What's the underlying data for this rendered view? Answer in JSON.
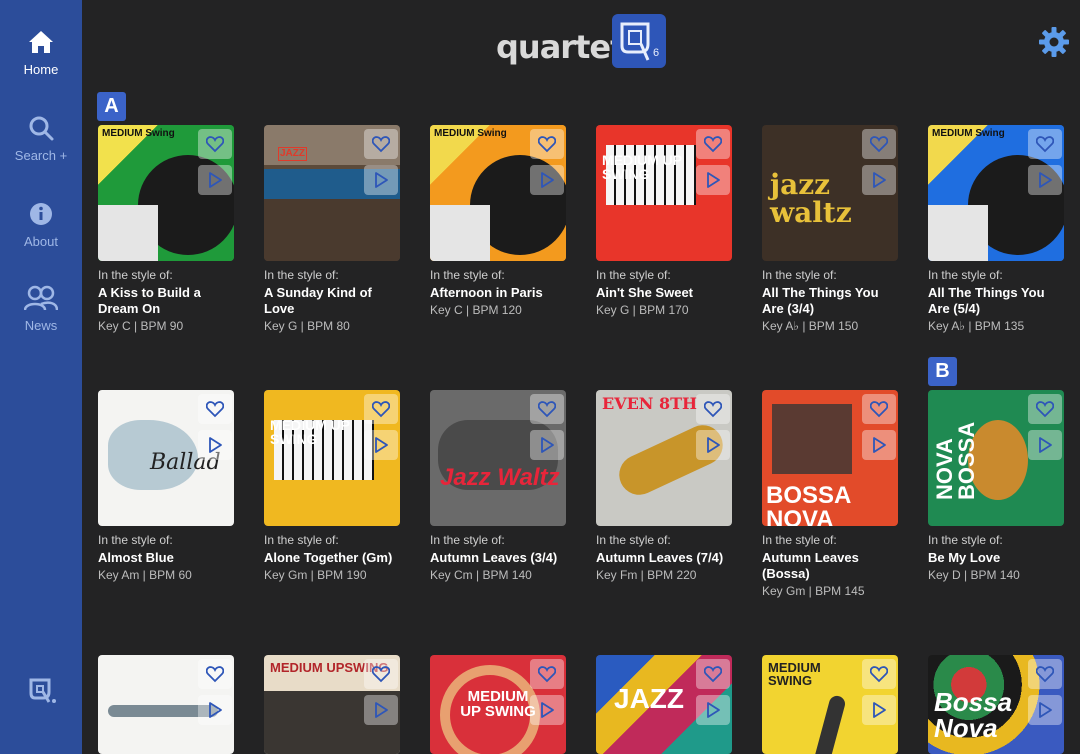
{
  "app": {
    "logo_text": "quartet",
    "logo_badge_superscript": "6"
  },
  "sidebar": {
    "items": [
      {
        "label": "Home",
        "icon": "home-icon",
        "active": true
      },
      {
        "label": "Search +",
        "icon": "search-icon",
        "active": false
      },
      {
        "label": "About",
        "icon": "info-icon",
        "active": false
      },
      {
        "label": "News",
        "icon": "people-icon",
        "active": false
      }
    ]
  },
  "header": {
    "settings_icon": "gear-icon"
  },
  "sections": {
    "a": "A",
    "b": "B"
  },
  "style_prefix": "In the style of:",
  "songs": [
    {
      "title": "A Kiss to Build a Dream On",
      "meta": "Key C | BPM 90",
      "cover": "MEDIUM Swing"
    },
    {
      "title": "A Sunday Kind of Love",
      "meta": "Key G | BPM 80",
      "cover": "JAZZ"
    },
    {
      "title": "Afternoon in Paris",
      "meta": "Key C | BPM 120",
      "cover": "MEDIUM Swing"
    },
    {
      "title": "Ain't She Sweet",
      "meta": "Key G | BPM 170",
      "cover": "MEDIUM UP SWING"
    },
    {
      "title": "All The Things You Are (3/4)",
      "meta": "Key A♭ | BPM 150",
      "cover": "jazz waltz"
    },
    {
      "title": "All The Things You Are (5/4)",
      "meta": "Key A♭ | BPM 135",
      "cover": "MEDIUM Swing"
    },
    {
      "title": "Almost Blue",
      "meta": "Key Am | BPM 60",
      "cover": "Ballad"
    },
    {
      "title": "Alone Together (Gm)",
      "meta": "Key Gm | BPM 190",
      "cover": "MEDIUM UP SWING"
    },
    {
      "title": "Autumn Leaves (3/4)",
      "meta": "Key Cm | BPM 140",
      "cover": "Jazz Waltz"
    },
    {
      "title": "Autumn Leaves (7/4)",
      "meta": "Key Fm | BPM 220",
      "cover": "EVEN 8TH"
    },
    {
      "title": "Autumn Leaves (Bossa)",
      "meta": "Key Gm | BPM 145",
      "cover": "BOSSA NOVA"
    },
    {
      "title": "Be My Love",
      "meta": "Key D | BPM 140",
      "cover": "NOVA BOSSA"
    },
    {
      "title": "",
      "meta": "",
      "cover": ""
    },
    {
      "title": "",
      "meta": "",
      "cover": "MEDIUM UPSWING"
    },
    {
      "title": "",
      "meta": "",
      "cover": "MEDIUM UP SWING"
    },
    {
      "title": "",
      "meta": "",
      "cover": "JAZZ"
    },
    {
      "title": "",
      "meta": "",
      "cover": "MEDIUM SWING"
    },
    {
      "title": "",
      "meta": "",
      "cover": "Bossa Nova"
    }
  ],
  "colors": {
    "sidebar": "#2c4d9a",
    "background": "#232324",
    "accent": "#3b63c8"
  }
}
